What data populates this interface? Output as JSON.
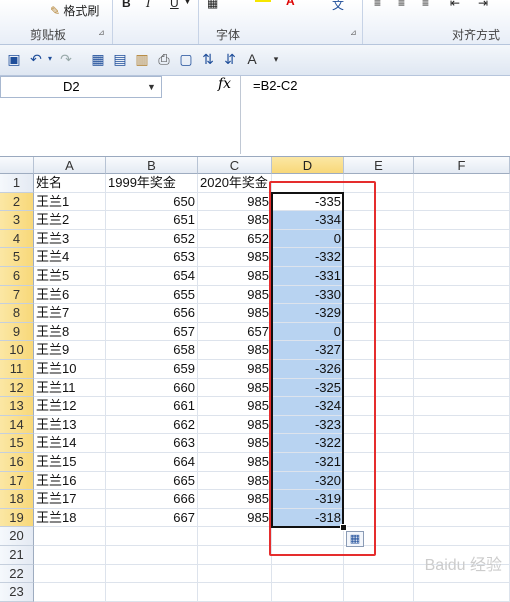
{
  "ribbon": {
    "format_painter": "格式刷",
    "bold": "B",
    "italic": "I",
    "underline": "U",
    "groups": [
      "剪贴板",
      "字体",
      "对齐方式"
    ]
  },
  "namebox": {
    "value": "D2"
  },
  "formula": {
    "fx": "fx",
    "value": "=B2-C2"
  },
  "columns": [
    "A",
    "B",
    "C",
    "D",
    "E",
    "F"
  ],
  "rows": [
    {
      "n": "1",
      "a": "姓名",
      "b": "1999年奖金",
      "c": "2020年奖金",
      "d": ""
    },
    {
      "n": "2",
      "a": "王兰1",
      "b": "650",
      "c": "985",
      "d": "-335"
    },
    {
      "n": "3",
      "a": "王兰2",
      "b": "651",
      "c": "985",
      "d": "-334"
    },
    {
      "n": "4",
      "a": "王兰3",
      "b": "652",
      "c": "652",
      "d": "0"
    },
    {
      "n": "5",
      "a": "王兰4",
      "b": "653",
      "c": "985",
      "d": "-332"
    },
    {
      "n": "6",
      "a": "王兰5",
      "b": "654",
      "c": "985",
      "d": "-331"
    },
    {
      "n": "7",
      "a": "王兰6",
      "b": "655",
      "c": "985",
      "d": "-330"
    },
    {
      "n": "8",
      "a": "王兰7",
      "b": "656",
      "c": "985",
      "d": "-329"
    },
    {
      "n": "9",
      "a": "王兰8",
      "b": "657",
      "c": "657",
      "d": "0"
    },
    {
      "n": "10",
      "a": "王兰9",
      "b": "658",
      "c": "985",
      "d": "-327"
    },
    {
      "n": "11",
      "a": "王兰10",
      "b": "659",
      "c": "985",
      "d": "-326"
    },
    {
      "n": "12",
      "a": "王兰11",
      "b": "660",
      "c": "985",
      "d": "-325"
    },
    {
      "n": "13",
      "a": "王兰12",
      "b": "661",
      "c": "985",
      "d": "-324"
    },
    {
      "n": "14",
      "a": "王兰13",
      "b": "662",
      "c": "985",
      "d": "-323"
    },
    {
      "n": "15",
      "a": "王兰14",
      "b": "663",
      "c": "985",
      "d": "-322"
    },
    {
      "n": "16",
      "a": "王兰15",
      "b": "664",
      "c": "985",
      "d": "-321"
    },
    {
      "n": "17",
      "a": "王兰16",
      "b": "665",
      "c": "985",
      "d": "-320"
    },
    {
      "n": "18",
      "a": "王兰17",
      "b": "666",
      "c": "985",
      "d": "-319"
    },
    {
      "n": "19",
      "a": "王兰18",
      "b": "667",
      "c": "985",
      "d": "-318"
    },
    {
      "n": "20",
      "a": "",
      "b": "",
      "c": "",
      "d": ""
    },
    {
      "n": "21",
      "a": "",
      "b": "",
      "c": "",
      "d": ""
    },
    {
      "n": "22",
      "a": "",
      "b": "",
      "c": "",
      "d": ""
    },
    {
      "n": "23",
      "a": "",
      "b": "",
      "c": "",
      "d": ""
    }
  ],
  "colors": {
    "selection": "#b8d3f1",
    "highlight_box": "#e52d2d"
  }
}
